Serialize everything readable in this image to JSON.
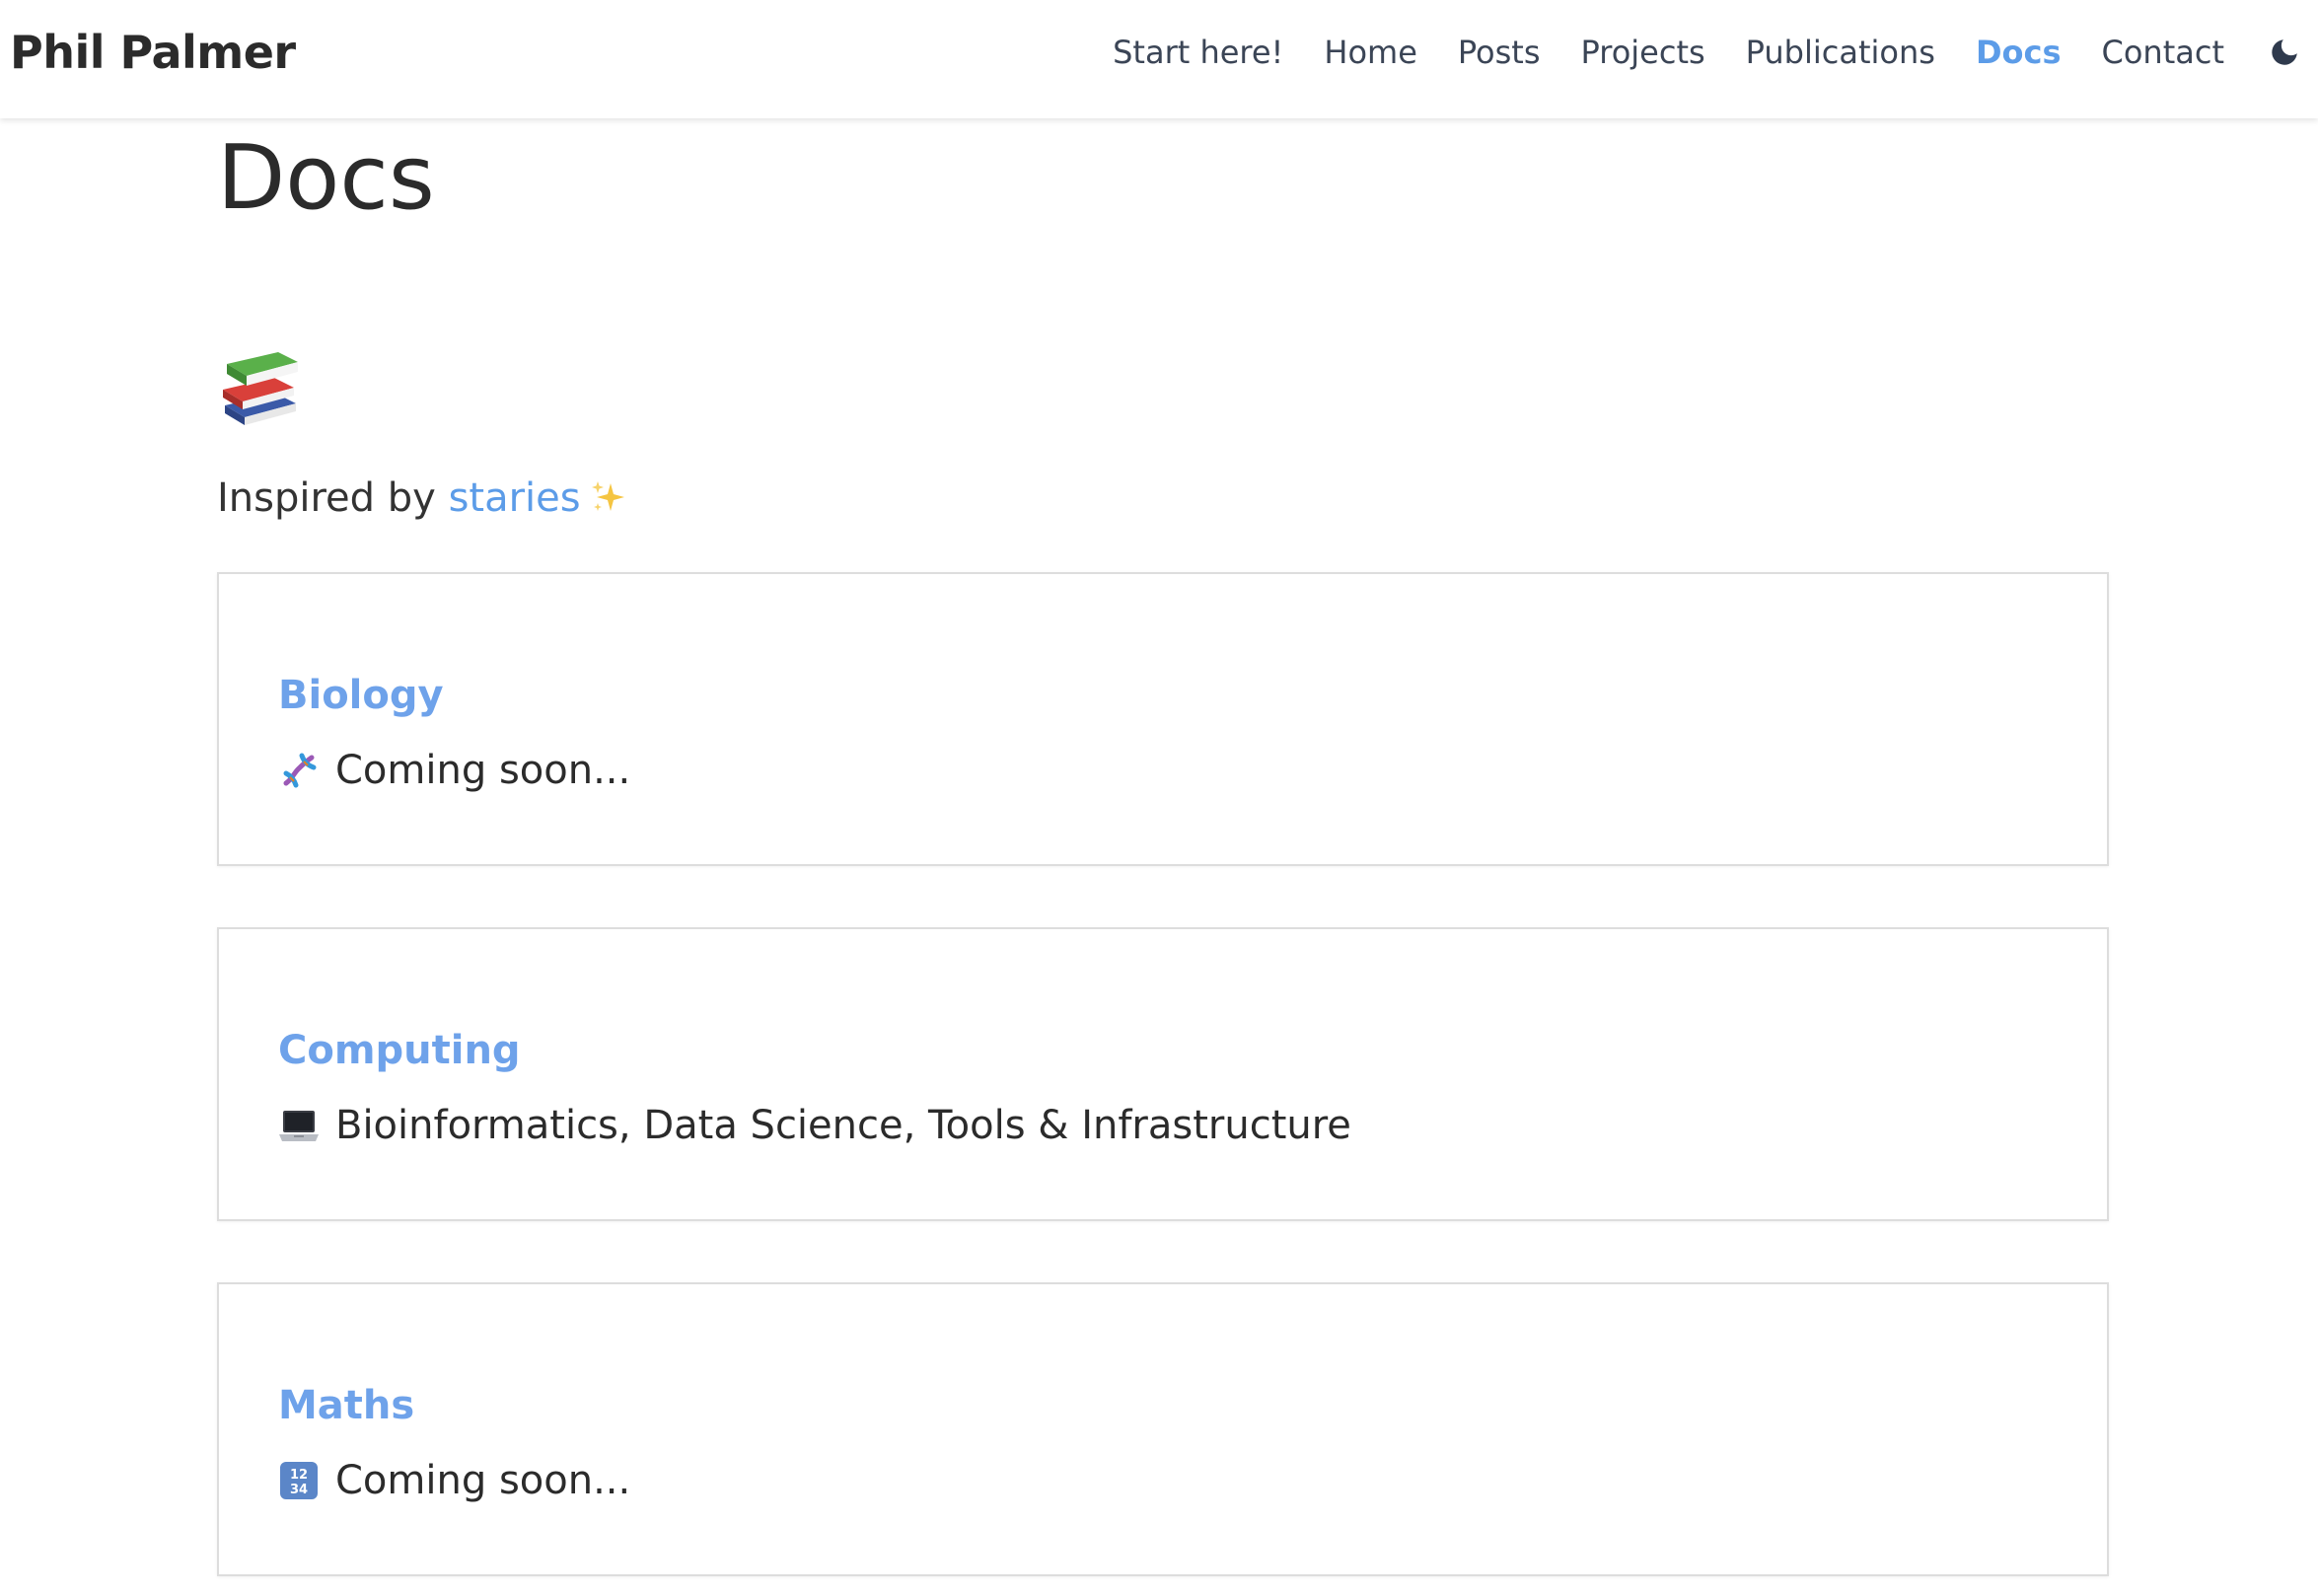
{
  "site": {
    "brand": "Phil Palmer"
  },
  "nav": {
    "items": [
      {
        "label": "Start here!",
        "active": false
      },
      {
        "label": "Home",
        "active": false
      },
      {
        "label": "Posts",
        "active": false
      },
      {
        "label": "Projects",
        "active": false
      },
      {
        "label": "Publications",
        "active": false
      },
      {
        "label": "Docs",
        "active": true
      },
      {
        "label": "Contact",
        "active": false
      }
    ],
    "theme_toggle_icon": "moon-icon"
  },
  "page": {
    "title": "Docs",
    "header_icon": "books-icon",
    "inspired_prefix": "Inspired by",
    "inspired_link": "staries",
    "inspired_icon": "sparkles-icon"
  },
  "cards": [
    {
      "title": "Biology",
      "icon": "dna-icon",
      "description": "Coming soon..."
    },
    {
      "title": "Computing",
      "icon": "laptop-icon",
      "description": "Bioinformatics, Data Science, Tools & Infrastructure"
    },
    {
      "title": "Maths",
      "icon": "numbers-icon",
      "description": "Coming soon..."
    }
  ],
  "colors": {
    "accent": "#5c9ce8",
    "card_title": "#6ea2ea",
    "nav_text": "#3b4556",
    "text": "#2b2b2b",
    "card_border": "#dddddd"
  }
}
